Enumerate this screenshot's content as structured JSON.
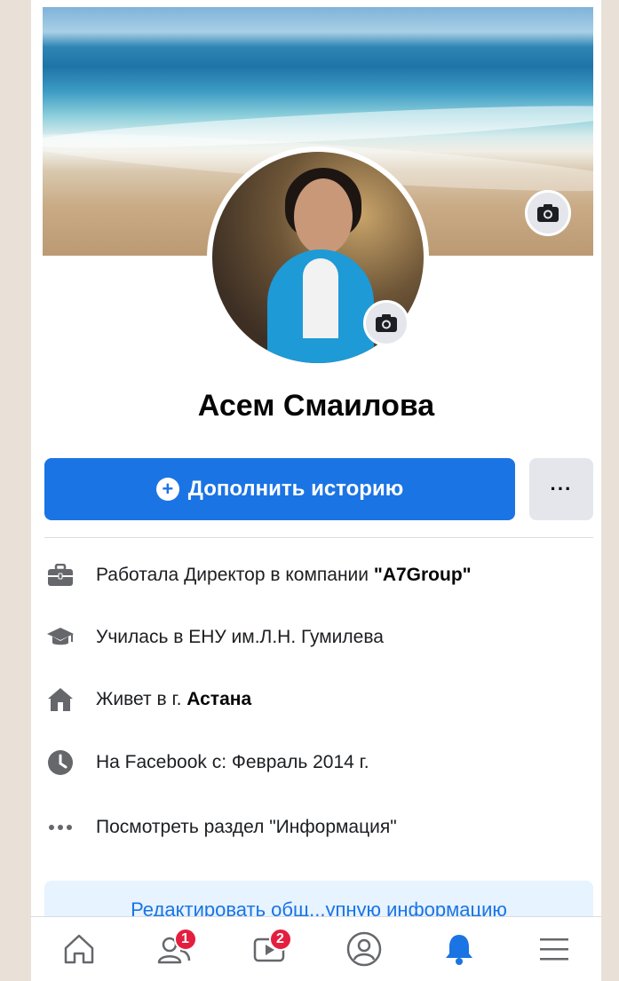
{
  "profile": {
    "name": "Асем Смаилова"
  },
  "actions": {
    "add_story_label": "Дополнить историю",
    "more_label": "···"
  },
  "info": [
    {
      "icon": "briefcase-icon",
      "prefix": "Работала Директор в компании ",
      "bold": "\"A7Group\""
    },
    {
      "icon": "graduation-cap-icon",
      "prefix": "Училась в ЕНУ им.Л.Н. Гумилева",
      "bold": ""
    },
    {
      "icon": "home-icon",
      "prefix": "Живет в г. ",
      "bold": "Астана"
    },
    {
      "icon": "clock-icon",
      "prefix": "На Facebook с: Февраль 2014 г.",
      "bold": ""
    },
    {
      "icon": "more-dots-icon",
      "prefix": "Посмотреть раздел \"Информация\"",
      "bold": ""
    }
  ],
  "edit": {
    "link_text": "Редактировать общ...упную информацию"
  },
  "nav": {
    "items": [
      {
        "icon": "home-icon",
        "badge": ""
      },
      {
        "icon": "friends-icon",
        "badge": "1"
      },
      {
        "icon": "watch-icon",
        "badge": "2"
      },
      {
        "icon": "profile-icon",
        "badge": ""
      },
      {
        "icon": "bell-icon",
        "badge": ""
      },
      {
        "icon": "menu-icon",
        "badge": ""
      }
    ]
  },
  "colors": {
    "primary": "#1b74e4",
    "badge": "#e41e3f",
    "secondary_button": "#e4e6eb",
    "edit_box": "#e7f3ff"
  }
}
